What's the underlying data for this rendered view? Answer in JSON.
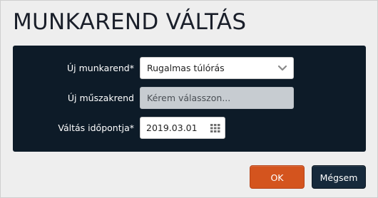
{
  "dialog": {
    "title": "MUNKAREND VÁLTÁS"
  },
  "form": {
    "work_schedule": {
      "label": "Új munkarend*",
      "value": "Rugalmas túlórás"
    },
    "shift_schedule": {
      "label": "Új műszakrend",
      "placeholder": "Kérem válasszon..."
    },
    "change_date": {
      "label": "Váltás időpontja*",
      "value": "2019.03.01"
    }
  },
  "buttons": {
    "ok": "OK",
    "cancel": "Mégsem"
  },
  "colors": {
    "panel_background": "#0d1b28",
    "ok_button": "#d4541e",
    "cancel_button": "#16293b",
    "disabled_field": "#c7ccd1"
  },
  "icons": {
    "dropdown": "chevron-down-icon",
    "date_picker": "calendar-grid-icon"
  }
}
